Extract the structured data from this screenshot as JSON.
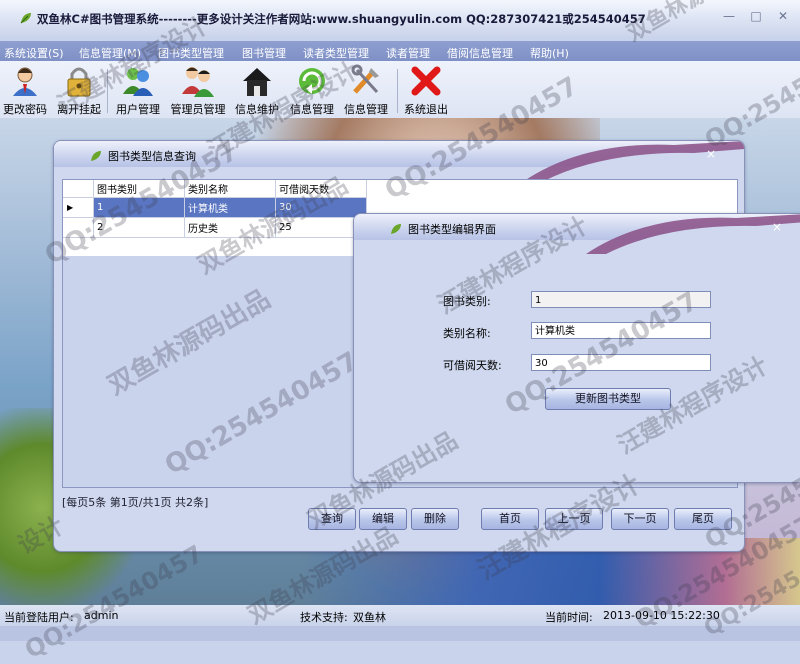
{
  "app": {
    "title": "双鱼林C#图书管理系统--------更多设计关注作者网站:www.shuangyulin.com  QQ:287307421或254540457"
  },
  "window_controls": {
    "minimize": "—",
    "maximize": "□",
    "close": "✕"
  },
  "menu": [
    {
      "label": "系统设置(S)"
    },
    {
      "label": "信息管理(M)"
    },
    {
      "label": "图书类型管理"
    },
    {
      "label": "图书管理"
    },
    {
      "label": "读者类型管理"
    },
    {
      "label": "读者管理"
    },
    {
      "label": "借阅信息管理"
    },
    {
      "label": "帮助(H)"
    }
  ],
  "toolbar": [
    {
      "label": "更改密码",
      "icon": "user-key-icon"
    },
    {
      "label": "离开挂起",
      "icon": "lock-icon"
    },
    {
      "label": "用户管理",
      "icon": "users-icon"
    },
    {
      "label": "管理员管理",
      "icon": "admins-icon"
    },
    {
      "label": "信息维护",
      "icon": "home-icon"
    },
    {
      "label": "信息管理",
      "icon": "refresh-icon"
    },
    {
      "label": "信息管理",
      "icon": "tools-icon"
    },
    {
      "label": "系统退出",
      "icon": "exit-x-icon"
    }
  ],
  "query_window": {
    "title": "图书类型信息查询",
    "close": "×",
    "columns": [
      "图书类别",
      "类别名称",
      "可借阅天数"
    ],
    "rows": [
      [
        "1",
        "计算机类",
        "30"
      ],
      [
        "2",
        "历史类",
        "25"
      ]
    ],
    "row_indicator": "▶",
    "pager_text": "[每页5条  第1页/共1页    共2条]",
    "buttons": {
      "query": "查询",
      "edit": "编辑",
      "delete": "删除",
      "first": "首页",
      "prev": "上一页",
      "next": "下一页",
      "last": "尾页"
    }
  },
  "edit_window": {
    "title": "图书类型编辑界面",
    "close": "×",
    "fields": {
      "category_label": "图书类别:",
      "category_value": "1",
      "name_label": "类别名称:",
      "name_value": "计算机类",
      "days_label": "可借阅天数:",
      "days_value": "30"
    },
    "update_button": "更新图书类型"
  },
  "status": {
    "user_label": "当前登陆用户:",
    "user_value": "admin",
    "support_label": "技术支持:",
    "support_value": "双鱼林",
    "time_label": "当前时间:",
    "time_value": "2013-09-10 15:22:30"
  },
  "watermarks": [
    "QQ:254540457",
    "双鱼林源码出品",
    "汪建林程序设计",
    "双鱼林源码出品",
    "汪建林程序设计",
    "QQ:254540457",
    "QQ:254540457",
    "QQ:254540457",
    "汪建林程序设计",
    "汪建林程序设计",
    "双鱼林源码出品",
    "QQ:254540457",
    "汪建林程序设计",
    "QQ:254540457",
    "双鱼林源码出品",
    "QQ:254540457",
    "双鱼林源码出品",
    "QQ:254540457",
    "设计",
    "QQ:2545"
  ],
  "colors": {
    "menubar": "#8393ca",
    "selected_row": "#5a76c2",
    "window_bg": "#cfd8ee",
    "accent_wave": "#8a4f86"
  }
}
